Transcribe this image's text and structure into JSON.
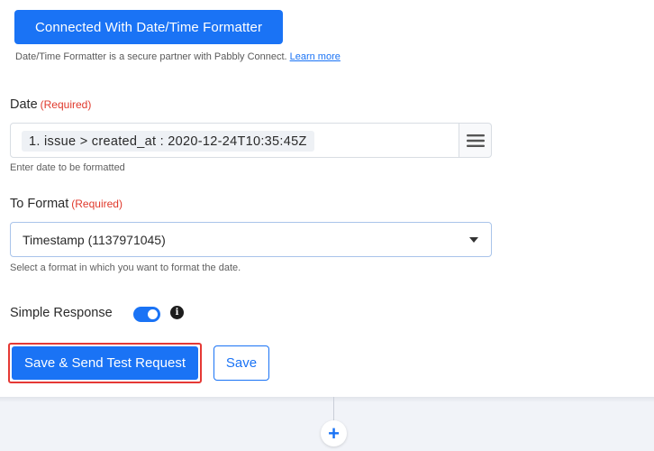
{
  "header": {
    "connected_label": "Connected With Date/Time Formatter",
    "partner_note": "Date/Time Formatter is a secure partner with Pabbly Connect.",
    "learn_more": "Learn more"
  },
  "date_field": {
    "label": "Date",
    "required": "(Required)",
    "value": "1. issue > created_at : 2020-12-24T10:35:45Z",
    "hint": "Enter date to be formatted",
    "menu_icon": "hamburger-icon"
  },
  "format_field": {
    "label": "To Format",
    "required": "(Required)",
    "selected": "Timestamp (1137971045)",
    "hint": "Select a format in which you want to format the date."
  },
  "simple_response": {
    "label": "Simple Response",
    "enabled": true,
    "info_icon": "i"
  },
  "actions": {
    "send_label": "Save & Send Test Request",
    "save_label": "Save"
  },
  "add_step": {
    "icon": "+"
  },
  "colors": {
    "primary": "#1a73f5",
    "required": "#e0392c",
    "highlight": "#e53935"
  }
}
